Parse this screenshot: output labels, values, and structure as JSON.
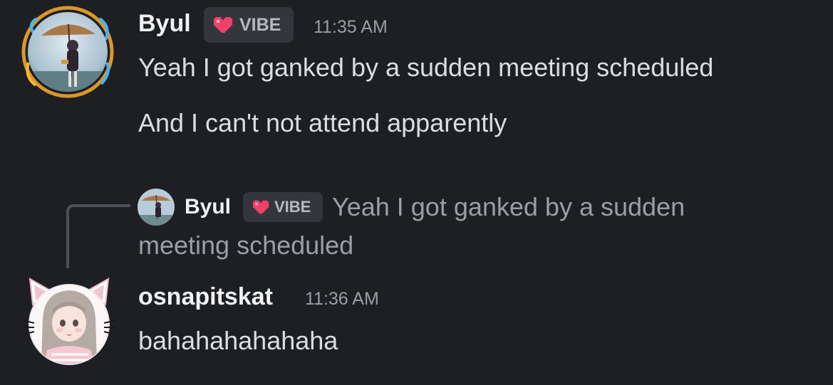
{
  "messages": [
    {
      "author": "Byul",
      "badge": "VIBE",
      "time": "11:35 AM",
      "lines": [
        "Yeah I got ganked by a sudden meeting scheduled",
        "And I can't not attend apparently"
      ]
    },
    {
      "reply": {
        "author": "Byul",
        "badge": "VIBE",
        "text_line1": "Yeah I got ganked by a sudden",
        "text_line2": "meeting scheduled"
      },
      "author": "osnapitskat",
      "time": "11:36 AM",
      "lines": [
        "bahahahahahaha"
      ]
    }
  ],
  "colors": {
    "background": "#1e1f23",
    "badge_heart": "#f23f6a",
    "badge_bg": "#34363d",
    "muted_text": "#9a9ea7"
  },
  "icons": {
    "badge": "pixel-heart-icon",
    "avatar_byul": "avatar-byul",
    "avatar_osnapitskat": "avatar-osnapitskat"
  }
}
